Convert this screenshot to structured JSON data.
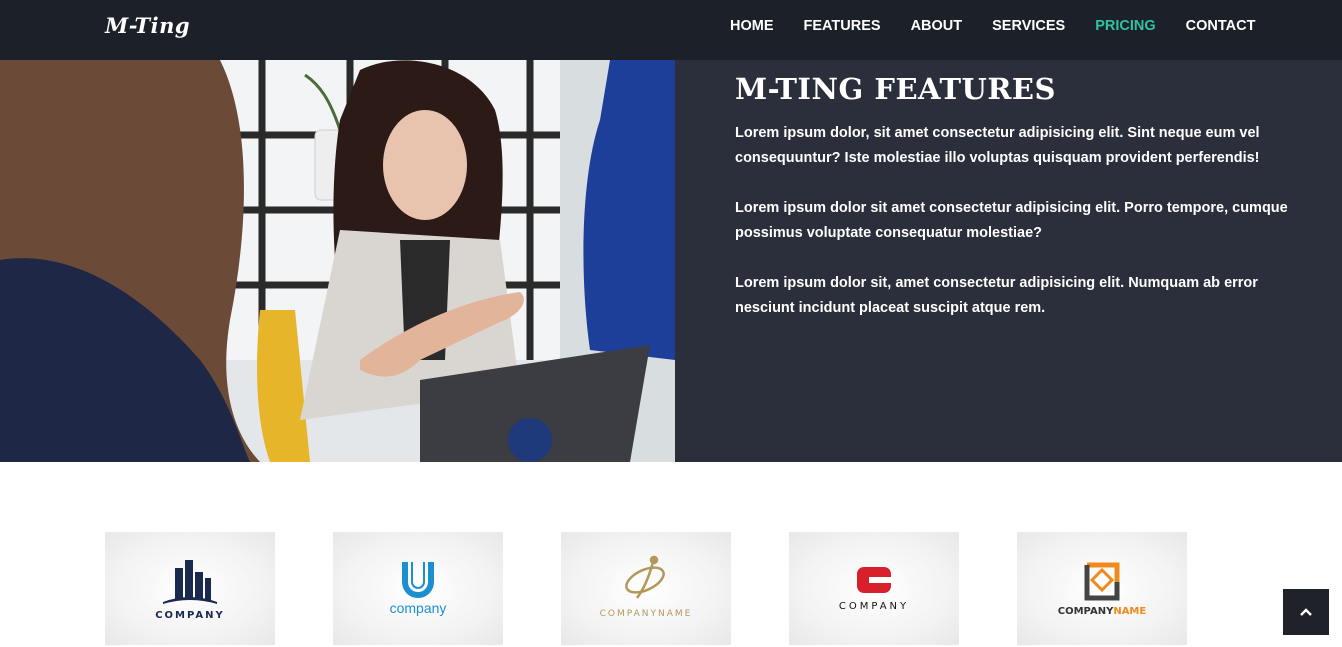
{
  "navbar": {
    "brand": "M-Ting",
    "links": [
      {
        "label": "HOME"
      },
      {
        "label": "FEATURES"
      },
      {
        "label": "ABOUT"
      },
      {
        "label": "SERVICES"
      },
      {
        "label": "PRICING",
        "active": true
      },
      {
        "label": "CONTACT"
      }
    ]
  },
  "features": {
    "title": "M-TING FEATURES",
    "paragraphs": [
      "Lorem ipsum dolor, sit amet consectetur adipisicing elit. Sint neque eum vel consequuntur? Iste molestiae illo voluptas quisquam provident perferendis!",
      "Lorem ipsum dolor sit amet consectetur adipisicing elit. Porro tempore, cumque possimus voluptate consequatur molestiae?",
      "Lorem ipsum dolor sit, amet consectetur adipisicing elit. Numquam ab error nesciunt incidunt placeat suscipit atque rem."
    ]
  },
  "clients": [
    {
      "text": "COMPANY",
      "icon": "buildings-logo-icon"
    },
    {
      "text": "company",
      "icon": "u-letter-logo-icon"
    },
    {
      "text": "COMPANYNAME",
      "icon": "swirl-logo-icon"
    },
    {
      "text": "COMPANY",
      "icon": "c-letter-logo-icon"
    },
    {
      "text_a": "COMPANY",
      "text_b": "NAME",
      "icon": "diamond-logo-icon"
    }
  ],
  "back_to_top": {
    "icon": "chevron-up-icon"
  },
  "colors": {
    "navbar_bg": "#1c2029",
    "panel_bg": "#2b2f3b",
    "accent": "#2ec4a0"
  }
}
